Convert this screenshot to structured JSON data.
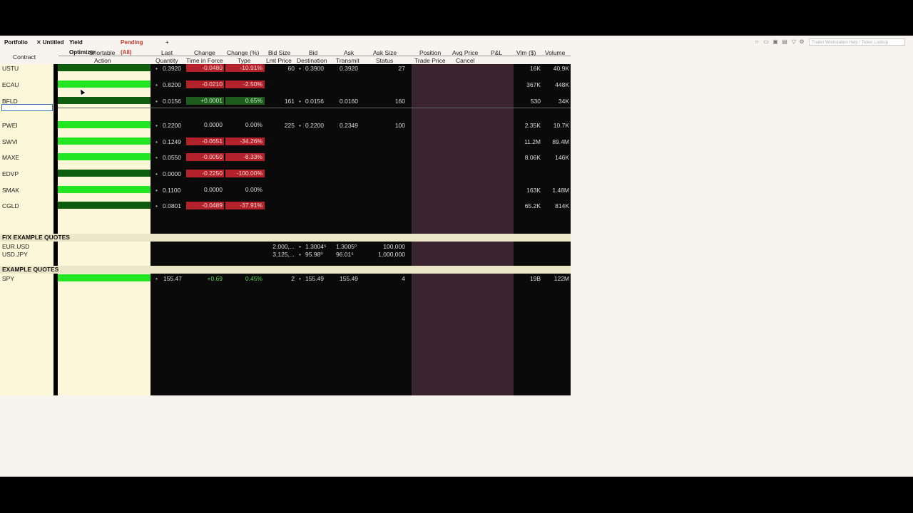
{
  "tabs": [
    {
      "label": "Portfolio"
    },
    {
      "label": "Untitled",
      "close": "✕"
    },
    {
      "label": "Yield Optimizer"
    },
    {
      "label": "Pending (All)"
    },
    {
      "label": "+"
    }
  ],
  "search": {
    "placeholder": "Trader Workstation Help / Ticker Lookup"
  },
  "headers": {
    "contract": "Contract",
    "shortable": "Shortable",
    "action": "Action",
    "last": "Last",
    "quantity": "Quantity",
    "change": "Change",
    "tif": "Time in Force",
    "change_pct": "Change (%)",
    "type": "Type",
    "bid_size": "Bid Size",
    "lmt_price": "Lmt Price",
    "bid": "Bid",
    "destination": "Destination",
    "ask": "Ask",
    "transmit": "Transmit",
    "ask_size": "Ask Size",
    "status": "Status",
    "position": "Position",
    "trade_price": "Trade Price",
    "avg_price": "Avg Price",
    "cancel": "Cancel",
    "pnl": "P&L",
    "vlm": "Vlm ($)",
    "volume": "Volume"
  },
  "rows": [
    {
      "sym": "USTU",
      "short": "dark",
      "last": "0.3920",
      "chg": "-0.0480",
      "pct": "-10.91%",
      "dir": "neg",
      "bidsz": "60",
      "bid": "0.3900",
      "ask": "0.3920",
      "asksz": "27",
      "vlm": "16K",
      "vol": "40.9K"
    },
    {
      "sym": "ECAU",
      "short": "bright",
      "last": "0.8200",
      "chg": "-0.0210",
      "pct": "-2.50%",
      "dir": "neg",
      "bidsz": "",
      "bid": "",
      "ask": "",
      "asksz": "",
      "vlm": "367K",
      "vol": "448K"
    },
    {
      "sym": "BFLD",
      "short": "dark",
      "last": "0.0156",
      "chg": "+0.0001",
      "pct": "0.65%",
      "dir": "pos",
      "bidsz": "161",
      "bid": "0.0156",
      "ask": "0.0160",
      "asksz": "160",
      "vlm": "530",
      "vol": "34K"
    },
    {
      "sym": "PWEI",
      "short": "bright",
      "last": "0.2200",
      "chg": "0.0000",
      "pct": "0.00%",
      "dir": "flat",
      "bidsz": "225",
      "bid": "0.2200",
      "ask": "0.2349",
      "asksz": "100",
      "vlm": "2.35K",
      "vol": "10.7K"
    },
    {
      "sym": "SWVI",
      "short": "bright",
      "last": "0.1249",
      "chg": "-0.0651",
      "pct": "-34.26%",
      "dir": "neg",
      "bidsz": "",
      "bid": "",
      "ask": "",
      "asksz": "",
      "vlm": "11.2M",
      "vol": "89.4M"
    },
    {
      "sym": "MAXE",
      "short": "bright",
      "last": "0.0550",
      "chg": "-0.0050",
      "pct": "-8.33%",
      "dir": "neg",
      "bidsz": "",
      "bid": "",
      "ask": "",
      "asksz": "",
      "vlm": "8.06K",
      "vol": "146K"
    },
    {
      "sym": "EDVP",
      "short": "dark",
      "last": "0.0000",
      "chg": "-0.2250",
      "pct": "-100.00%",
      "dir": "neg",
      "bidsz": "",
      "bid": "",
      "ask": "",
      "asksz": "",
      "vlm": "",
      "vol": ""
    },
    {
      "sym": "SMAK",
      "short": "bright",
      "last": "0.1100",
      "chg": "0.0000",
      "pct": "0.00%",
      "dir": "flat",
      "bidsz": "",
      "bid": "",
      "ask": "",
      "asksz": "",
      "vlm": "163K",
      "vol": "1.48M"
    },
    {
      "sym": "CGLD",
      "short": "dark",
      "last": "0.0801",
      "chg": "-0.0489",
      "pct": "-37.91%",
      "dir": "neg",
      "bidsz": "",
      "bid": "",
      "ask": "",
      "asksz": "",
      "vlm": "65.2K",
      "vol": "814K"
    }
  ],
  "fx_section": {
    "title": "F/X EXAMPLE QUOTES",
    "rows": [
      {
        "sym": "EUR.USD",
        "bidsz": "2,000,...",
        "bid": "1.3004⁵",
        "ask": "1.3005⁰",
        "asksz": "100,000"
      },
      {
        "sym": "USD.JPY",
        "bidsz": "3,125,...",
        "bid": "95.98⁰",
        "ask": "96.01⁵",
        "asksz": "1,000,000"
      }
    ]
  },
  "example_section": {
    "title": "EXAMPLE QUOTES",
    "rows": [
      {
        "sym": "SPY",
        "last": "155.47",
        "chg": "+0.69",
        "pct": "0.45%",
        "bidsz": "2",
        "bid": "155.49",
        "ask": "155.49",
        "asksz": "4",
        "vlm": "19B",
        "vol": "122M"
      }
    ]
  },
  "dot": "•",
  "colors": {
    "shortable_bright": "#22e622",
    "shortable_dark": "#0e5e0e",
    "negative": "#b3222a",
    "positive": "#1e5c1e"
  }
}
